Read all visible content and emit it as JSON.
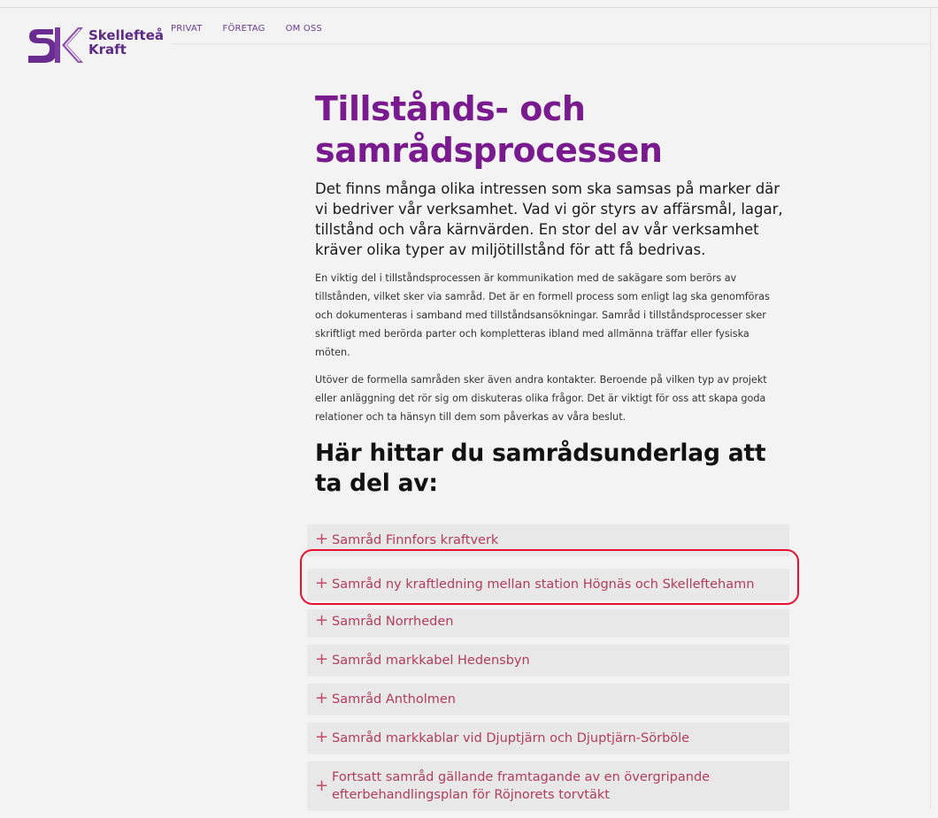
{
  "brand": {
    "logo_line1": "Skellefteå",
    "logo_line2": "Kraft",
    "color": "#5d2a84"
  },
  "nav": {
    "items": [
      {
        "label": "PRIVAT"
      },
      {
        "label": "FÖRETAG"
      },
      {
        "label": "OM OSS"
      }
    ]
  },
  "main": {
    "title_line1": "Tillstånds- och",
    "title_line2": "samrådsprocessen",
    "lead": "Det finns många olika intressen som ska samsas på marker där vi bedriver vår verksamhet. Vad vi gör styrs av affärsmål, lagar, tillstånd och våra kärnvärden. En stor del av vår verksamhet kräver olika typer av miljötillstånd för att få bedrivas.",
    "paragraph1": "En viktig del i tillståndsprocessen är kommunikation med de sakägare som berörs av tillstånden, vilket sker via samråd. Det är en formell process som enligt lag ska genomföras och dokumenteras i samband med tillståndsansökningar. Samråd i tillståndsprocesser sker skriftligt med berörda parter och kompletteras ibland med allmänna träffar eller fysiska möten.",
    "paragraph2": "Utöver de formella samråden sker även andra kontakter. Beroende på vilken typ av projekt eller anläggning det rör sig om diskuteras olika frågor. Det är viktigt för oss att skapa goda relationer och ta hänsyn till dem som påverkas av våra beslut.",
    "section_title": "Här hittar du samrådsunderlag att ta del av:"
  },
  "accordion": {
    "plus_symbol": "+",
    "items": [
      {
        "label": "Samråd Finnfors kraftverk"
      },
      {
        "label": "Samråd ny kraftledning mellan station Högnäs och Skelleftehamn"
      },
      {
        "label": "Samråd Norrheden"
      },
      {
        "label": "Samråd markkabel Hedensbyn"
      },
      {
        "label": "Samråd Antholmen"
      },
      {
        "label": "Samråd markkablar vid Djuptjärn och Djuptjärn-Sörböle"
      },
      {
        "label": "Fortsatt samråd gällande framtagande av en övergripande efterbehandlingsplan för Röjnorets torvtäkt"
      }
    ]
  },
  "colors": {
    "title": "#7a1a8f",
    "accordion_text": "#b23c5c",
    "highlight": "#e8112d"
  }
}
